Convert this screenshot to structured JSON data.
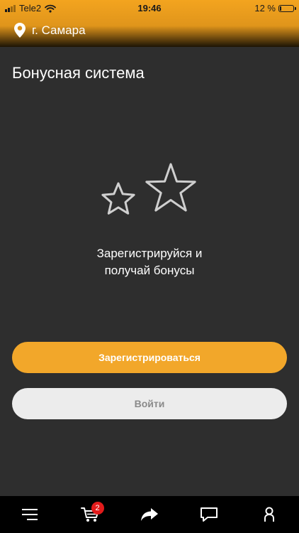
{
  "status_bar": {
    "carrier": "Tele2",
    "time": "19:46",
    "battery_percent": "12 %",
    "battery_level": 0.12,
    "signal_bars": 2
  },
  "header": {
    "location_icon": "location-pin-icon",
    "city": "г. Самара"
  },
  "page": {
    "title": "Бонусная система"
  },
  "promo": {
    "icon": "stars-icon",
    "line1": "Зарегистрируйся и",
    "line2": "получай бонусы"
  },
  "actions": {
    "register_label": "Зарегистрироваться",
    "login_label": "Войти"
  },
  "bottom_nav": {
    "items": [
      {
        "icon": "menu-icon"
      },
      {
        "icon": "cart-icon",
        "badge": "2"
      },
      {
        "icon": "share-icon"
      },
      {
        "icon": "chat-icon"
      },
      {
        "icon": "profile-icon"
      }
    ]
  },
  "colors": {
    "accent": "#f2a72a",
    "background": "#2e2e2e",
    "badge": "#e21b1b",
    "secondary_button": "#ececec"
  }
}
